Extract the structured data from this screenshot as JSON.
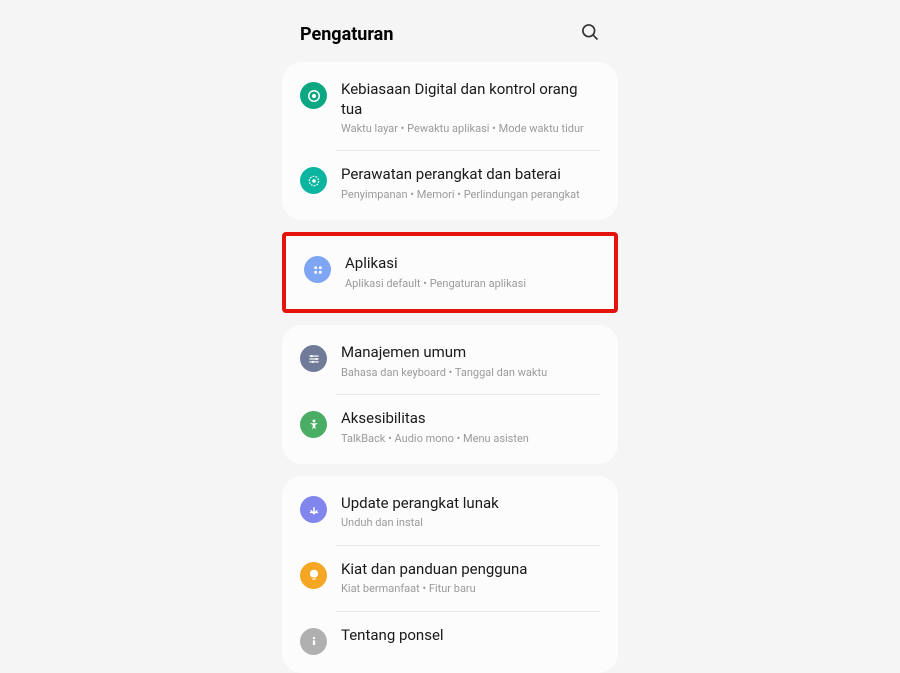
{
  "header": {
    "title": "Pengaturan"
  },
  "group1": {
    "items": [
      {
        "title": "Kebiasaan Digital dan kontrol orang tua",
        "sub": "Waktu layar  •  Pewaktu aplikasi  •  Mode waktu tidur"
      },
      {
        "title": "Perawatan perangkat dan baterai",
        "sub": "Penyimpanan  •  Memori  •  Perlindungan perangkat"
      }
    ]
  },
  "group2": {
    "items": [
      {
        "title": "Aplikasi",
        "sub": "Aplikasi default  •  Pengaturan aplikasi"
      }
    ]
  },
  "group3": {
    "items": [
      {
        "title": "Manajemen umum",
        "sub": "Bahasa dan keyboard  •  Tanggal dan waktu"
      },
      {
        "title": "Aksesibilitas",
        "sub": "TalkBack  •  Audio mono  •  Menu asisten"
      }
    ]
  },
  "group4": {
    "items": [
      {
        "title": "Update perangkat lunak",
        "sub": "Unduh dan instal"
      },
      {
        "title": "Kiat dan panduan pengguna",
        "sub": "Kiat bermanfaat  •  Fitur baru"
      },
      {
        "title": "Tentang ponsel",
        "sub": ""
      }
    ]
  }
}
